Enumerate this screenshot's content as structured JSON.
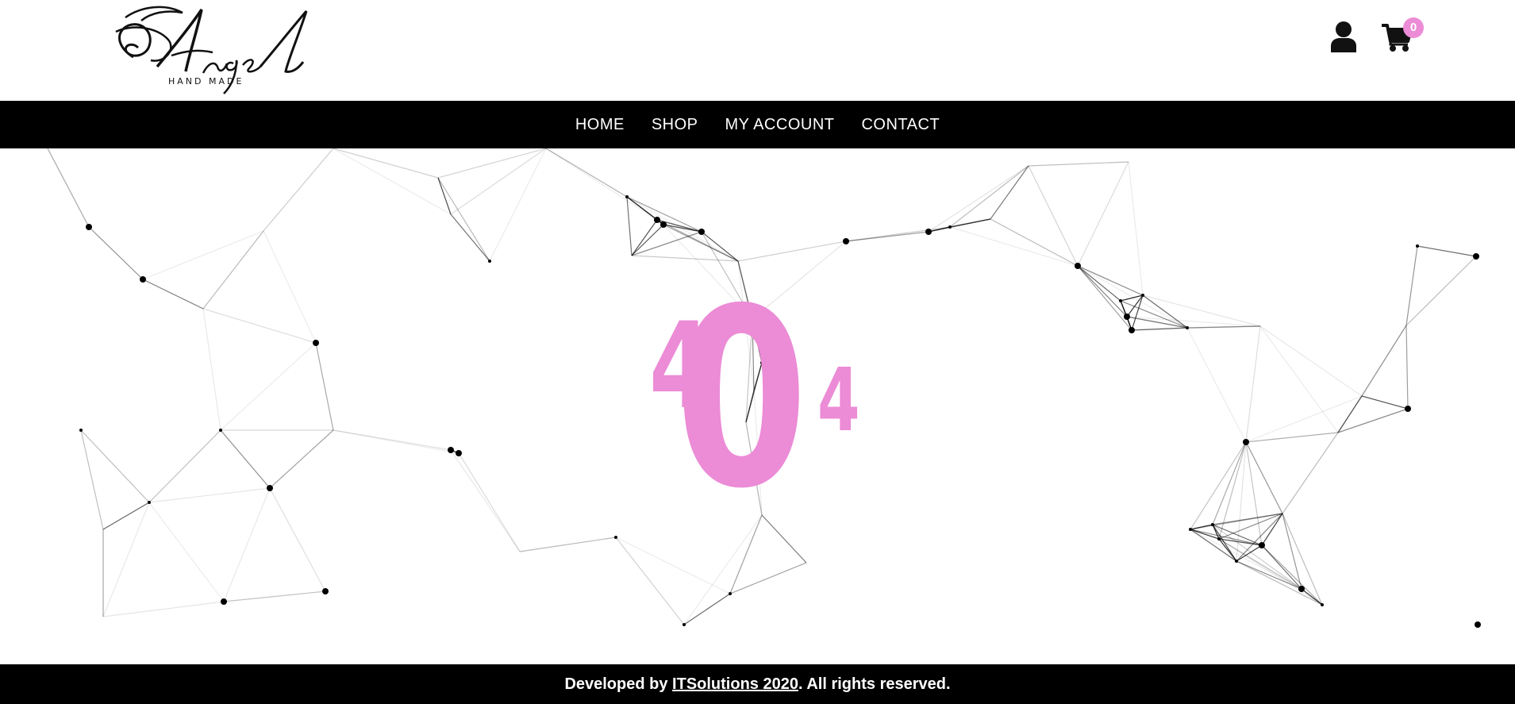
{
  "header": {
    "logo": {
      "script_text": "Angel",
      "subtitle": "HAND MADE"
    },
    "account_icon": "user-icon",
    "cart_icon": "cart-icon",
    "cart_count": "0"
  },
  "nav": {
    "items": [
      {
        "label": "HOME"
      },
      {
        "label": "SHOP"
      },
      {
        "label": "MY ACCOUNT"
      },
      {
        "label": "CONTACT"
      }
    ]
  },
  "error": {
    "digit_1": "4",
    "digit_2": "0",
    "digit_3": "4"
  },
  "footer": {
    "prefix": "Developed by ",
    "link_text": "ITSolutions 2020",
    "suffix": ". All rights reserved."
  },
  "colors": {
    "accent": "#ec8bd6",
    "nav_bg": "#000000",
    "footer_bg": "#000000"
  }
}
